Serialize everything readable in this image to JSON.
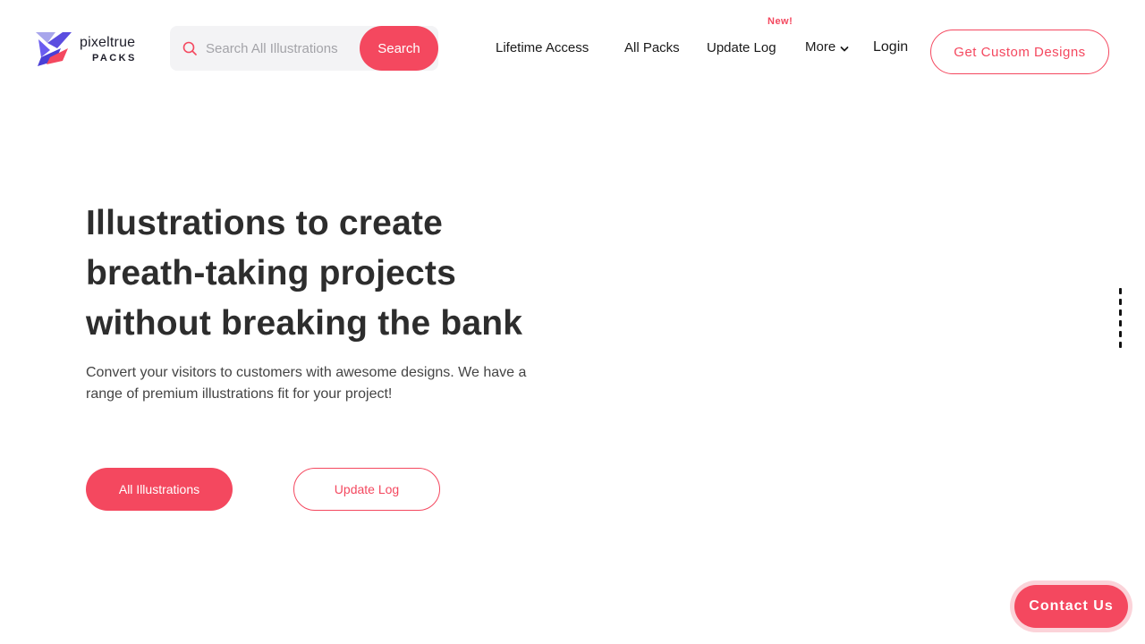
{
  "brand": {
    "name": "pixeltrue",
    "sub": "PACKS"
  },
  "search": {
    "placeholder": "Search All Illustrations",
    "button_label": "Search"
  },
  "nav": {
    "lifetime": "Lifetime Access",
    "all_packs": "All Packs",
    "update_log": "Update Log",
    "new_badge": "New!",
    "more": "More",
    "login": "Login",
    "custom": "Get Custom Designs"
  },
  "hero": {
    "title_lines": [
      "Illustrations to create",
      "breath-taking projects",
      "without breaking the bank"
    ],
    "subtitle": "Convert your visitors to customers with awesome designs. We have a range of premium illustrations fit for your project!",
    "primary_cta": "All Illustrations",
    "secondary_cta": "Update Log"
  },
  "contact": {
    "label": "Contact Us"
  },
  "icons": {
    "search": "search-icon",
    "chevron": "chevron-down-icon",
    "logo": "pixeltrue-logo-icon"
  },
  "colors": {
    "accent": "#f4485f",
    "accent_soft": "#fbd3d9",
    "text_dark": "#2d2d2d",
    "search_bg": "#f3f3f5"
  }
}
